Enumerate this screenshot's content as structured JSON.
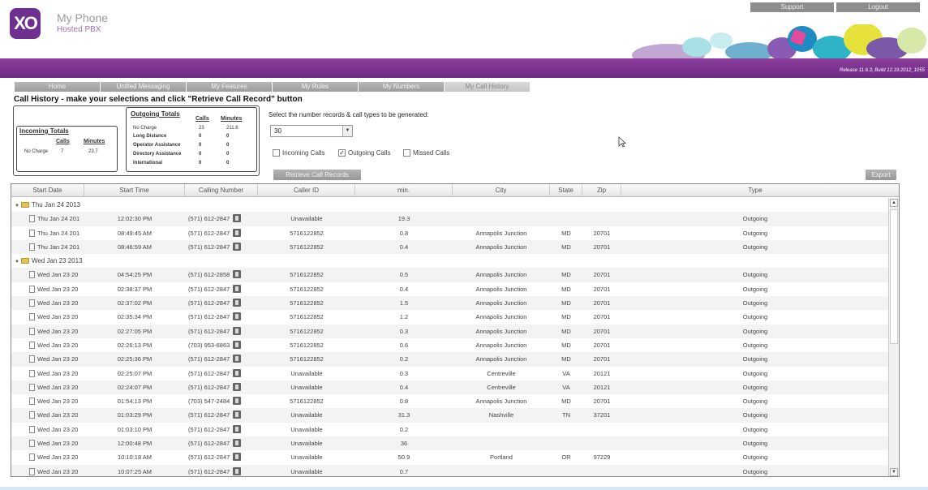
{
  "header": {
    "logo": "XO",
    "app_name": "My Phone",
    "app_sub": "Hosted PBX",
    "support": "Support",
    "logout": "Logout",
    "release": "Release 11.6.3, Build 12.19.2012_1055"
  },
  "nav": {
    "tabs": [
      "Home",
      "Unified Messaging",
      "My Features",
      "My Rules",
      "My Numbers",
      "My Call History"
    ],
    "active_index": 5
  },
  "page_title": "Call History - make your selections and click \"Retrieve Call Record\" button",
  "incoming_totals": {
    "title": "Incoming Totals",
    "calls_label": "Calls",
    "minutes_label": "Minutes",
    "rows": [
      {
        "label": "No Charge",
        "calls": "7",
        "minutes": "23.7"
      }
    ]
  },
  "outgoing_totals": {
    "title": "Outgoing Totals",
    "calls_label": "Calls",
    "minutes_label": "Minutes",
    "rows": [
      {
        "label": "No Charge",
        "calls": "23",
        "minutes": "211.6"
      },
      {
        "label": "Long Distance",
        "calls": "0",
        "minutes": "0"
      },
      {
        "label": "Operator Assistance",
        "calls": "0",
        "minutes": "0"
      },
      {
        "label": "Directory Assistance",
        "calls": "0",
        "minutes": "0"
      },
      {
        "label": "International",
        "calls": "0",
        "minutes": "0"
      }
    ]
  },
  "selection": {
    "label": "Select the number records & call types to be generated:",
    "record_count": "30",
    "incoming_label": "Incoming Calls",
    "incoming_checked": false,
    "outgoing_label": "Outgoing Calls",
    "outgoing_checked": true,
    "missed_label": "Missed Calls",
    "missed_checked": false,
    "retrieve_label": "Retrieve Call Records",
    "export_label": "Export"
  },
  "grid": {
    "columns": [
      "Start Date",
      "Start Time",
      "Calling Number",
      "Caller ID",
      "min.",
      "City",
      "State",
      "Zip",
      "Type"
    ],
    "rows": [
      {
        "group": "Thu Jan 24 2013"
      },
      {
        "date": "Thu Jan 24 201",
        "time": "12:02:30 PM",
        "number": "(571) 612-2847",
        "caller_id": "Unavailable",
        "min": "19.3",
        "city": "",
        "state": "",
        "zip": "",
        "type": "Outgoing"
      },
      {
        "date": "Thu Jan 24 201",
        "time": "08:49:45 AM",
        "number": "(571) 612-2847",
        "caller_id": "5716122852",
        "min": "0.8",
        "city": "Annapolis Junction",
        "state": "MD",
        "zip": "20701",
        "type": "Outgoing"
      },
      {
        "date": "Thu Jan 24 201",
        "time": "08:46:59 AM",
        "number": "(571) 612-2847",
        "caller_id": "5716122852",
        "min": "0.4",
        "city": "Annapolis Junction",
        "state": "MD",
        "zip": "20701",
        "type": "Outgoing"
      },
      {
        "group": "Wed Jan 23 2013"
      },
      {
        "date": "Wed Jan 23 20",
        "time": "04:54:25 PM",
        "number": "(571) 612-2858",
        "caller_id": "5716122852",
        "min": "0.5",
        "city": "Annapolis Junction",
        "state": "MD",
        "zip": "20701",
        "type": "Outgoing"
      },
      {
        "date": "Wed Jan 23 20",
        "time": "02:38:37 PM",
        "number": "(571) 612-2847",
        "caller_id": "5716122852",
        "min": "0.4",
        "city": "Annapolis Junction",
        "state": "MD",
        "zip": "20701",
        "type": "Outgoing"
      },
      {
        "date": "Wed Jan 23 20",
        "time": "02:37:02 PM",
        "number": "(571) 612-2847",
        "caller_id": "5716122852",
        "min": "1.5",
        "city": "Annapolis Junction",
        "state": "MD",
        "zip": "20701",
        "type": "Outgoing"
      },
      {
        "date": "Wed Jan 23 20",
        "time": "02:35:34 PM",
        "number": "(571) 612-2847",
        "caller_id": "5716122852",
        "min": "1.2",
        "city": "Annapolis Junction",
        "state": "MD",
        "zip": "20701",
        "type": "Outgoing"
      },
      {
        "date": "Wed Jan 23 20",
        "time": "02:27:05 PM",
        "number": "(571) 612-2847",
        "caller_id": "5716122852",
        "min": "0.3",
        "city": "Annapolis Junction",
        "state": "MD",
        "zip": "20701",
        "type": "Outgoing"
      },
      {
        "date": "Wed Jan 23 20",
        "time": "02:26:13 PM",
        "number": "(703) 953-6863",
        "caller_id": "5716122852",
        "min": "0.6",
        "city": "Annapolis Junction",
        "state": "MD",
        "zip": "20701",
        "type": "Outgoing"
      },
      {
        "date": "Wed Jan 23 20",
        "time": "02:25:36 PM",
        "number": "(571) 612-2847",
        "caller_id": "5716122852",
        "min": "0.2",
        "city": "Annapolis Junction",
        "state": "MD",
        "zip": "20701",
        "type": "Outgoing"
      },
      {
        "date": "Wed Jan 23 20",
        "time": "02:25:07 PM",
        "number": "(571) 612-2847",
        "caller_id": "Unavailable",
        "min": "0.3",
        "city": "Centreville",
        "state": "VA",
        "zip": "20121",
        "type": "Outgoing"
      },
      {
        "date": "Wed Jan 23 20",
        "time": "02:24:07 PM",
        "number": "(571) 612-2847",
        "caller_id": "Unavailable",
        "min": "0.4",
        "city": "Centreville",
        "state": "VA",
        "zip": "20121",
        "type": "Outgoing"
      },
      {
        "date": "Wed Jan 23 20",
        "time": "01:54:13 PM",
        "number": "(703) 547-2484",
        "caller_id": "5716122852",
        "min": "0.8",
        "city": "Annapolis Junction",
        "state": "MD",
        "zip": "20701",
        "type": "Outgoing"
      },
      {
        "date": "Wed Jan 23 20",
        "time": "01:03:29 PM",
        "number": "(571) 612-2847",
        "caller_id": "Unavailable",
        "min": "31.3",
        "city": "Nashville",
        "state": "TN",
        "zip": "37201",
        "type": "Outgoing"
      },
      {
        "date": "Wed Jan 23 20",
        "time": "01:03:10 PM",
        "number": "(571) 612-2847",
        "caller_id": "Unavailable",
        "min": "0.2",
        "city": "",
        "state": "",
        "zip": "",
        "type": "Outgoing"
      },
      {
        "date": "Wed Jan 23 20",
        "time": "12:00:48 PM",
        "number": "(571) 612-2847",
        "caller_id": "Unavailable",
        "min": "36",
        "city": "",
        "state": "",
        "zip": "",
        "type": "Outgoing"
      },
      {
        "date": "Wed Jan 23 20",
        "time": "10:10:18 AM",
        "number": "(571) 612-2847",
        "caller_id": "Unavailable",
        "min": "50.9",
        "city": "Portland",
        "state": "OR",
        "zip": "97229",
        "type": "Outgoing"
      },
      {
        "date": "Wed Jan 23 20",
        "time": "10:07:25 AM",
        "number": "(571) 612-2847",
        "caller_id": "Unavailable",
        "min": "0.7",
        "city": "",
        "state": "",
        "zip": "",
        "type": "Outgoing"
      }
    ]
  },
  "colors": {
    "brand_purple": "#6e2a85",
    "logo_purple": "#6f2f8f"
  }
}
